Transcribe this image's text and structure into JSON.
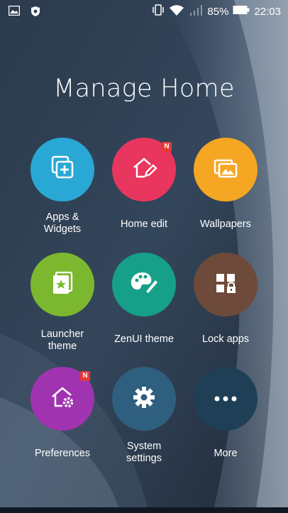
{
  "status_bar": {
    "battery_percent": "85%",
    "time": "22:03",
    "icons": [
      "image-icon",
      "vpn-shield-icon",
      "vibrate-icon",
      "wifi-icon",
      "signal-icon",
      "battery-icon"
    ]
  },
  "title": "Manage Home",
  "tiles": [
    {
      "label": "Apps &\nWidgets",
      "color": "#29a8d6",
      "icon": "apps-widgets-icon",
      "badge": ""
    },
    {
      "label": "Home edit",
      "color": "#e8365e",
      "icon": "home-edit-icon",
      "badge": "N"
    },
    {
      "label": "Wallpapers",
      "color": "#f5a623",
      "icon": "wallpapers-icon",
      "badge": ""
    },
    {
      "label": "Launcher\ntheme",
      "color": "#7cb82f",
      "icon": "launcher-theme-icon",
      "badge": ""
    },
    {
      "label": "ZenUI theme",
      "color": "#16a08a",
      "icon": "palette-icon",
      "badge": ""
    },
    {
      "label": "Lock apps",
      "color": "#6e4a3a",
      "icon": "lock-apps-icon",
      "badge": ""
    },
    {
      "label": "Preferences",
      "color": "#a033b0",
      "icon": "preferences-icon",
      "badge": "N"
    },
    {
      "label": "System\nsettings",
      "color": "#2e5f7e",
      "icon": "gear-icon",
      "badge": ""
    },
    {
      "label": "More",
      "color": "#1e3f55",
      "icon": "more-icon",
      "badge": ""
    }
  ]
}
